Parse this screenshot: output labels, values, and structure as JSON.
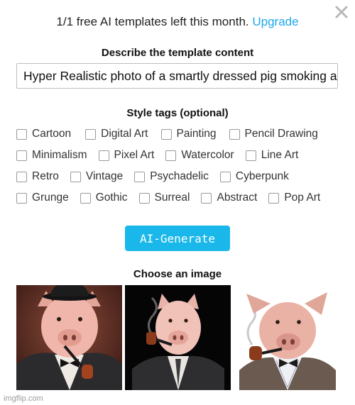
{
  "header": {
    "quota_text": "1/1 free AI templates left this month.",
    "upgrade_link": "Upgrade",
    "close_icon": "close-icon"
  },
  "describe": {
    "title": "Describe the template content",
    "value": "Hyper Realistic photo of a smartly dressed pig smoking a pipe"
  },
  "style_tags": {
    "title": "Style tags (optional)",
    "rows": [
      [
        "Cartoon",
        "Digital Art",
        "Painting",
        "Pencil Drawing"
      ],
      [
        "Minimalism",
        "Pixel Art",
        "Watercolor",
        "Line Art"
      ],
      [
        "Retro",
        "Vintage",
        "Psychadelic",
        "Cyberpunk"
      ],
      [
        "Grunge",
        "Gothic",
        "Surreal",
        "Abstract",
        "Pop Art"
      ]
    ]
  },
  "generate_button": "AI-Generate",
  "choose": {
    "title": "Choose an image",
    "images": [
      {
        "subject": "pig in bowler hat with pipe and bow tie"
      },
      {
        "subject": "pig in suit smoking pipe on black background"
      },
      {
        "subject": "pig with pipe and bow tie on white background"
      }
    ]
  },
  "watermark": "imgflip.com",
  "colors": {
    "accent": "#1ab8ea",
    "link": "#1aa7e8"
  }
}
